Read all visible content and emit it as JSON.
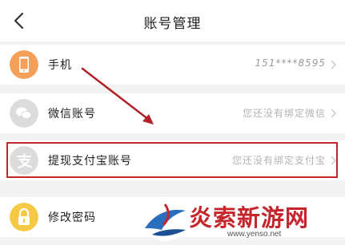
{
  "header": {
    "title": "账号管理"
  },
  "rows": [
    {
      "label": "手机",
      "value": "151****8595"
    },
    {
      "label": "微信账号",
      "value": "您还没有绑定微信"
    },
    {
      "label": "提现支付宝账号",
      "value": "您还没有绑定支付宝"
    },
    {
      "label": "修改密码"
    }
  ],
  "icons": {
    "phone": "phone-icon",
    "wechat": "wechat-icon",
    "alipay": "alipay-icon",
    "lock": "lock-icon"
  },
  "colors": {
    "phone_icon_bg": "#f5a05a",
    "wechat_icon_bg": "#dcdcdc",
    "alipay_icon_bg": "#dcdcdc",
    "lock_icon_bg": "#f6c945",
    "annotation_red": "#c0272d"
  },
  "watermark": {
    "text": "炎索新游网",
    "url": "www.yenso.net"
  }
}
